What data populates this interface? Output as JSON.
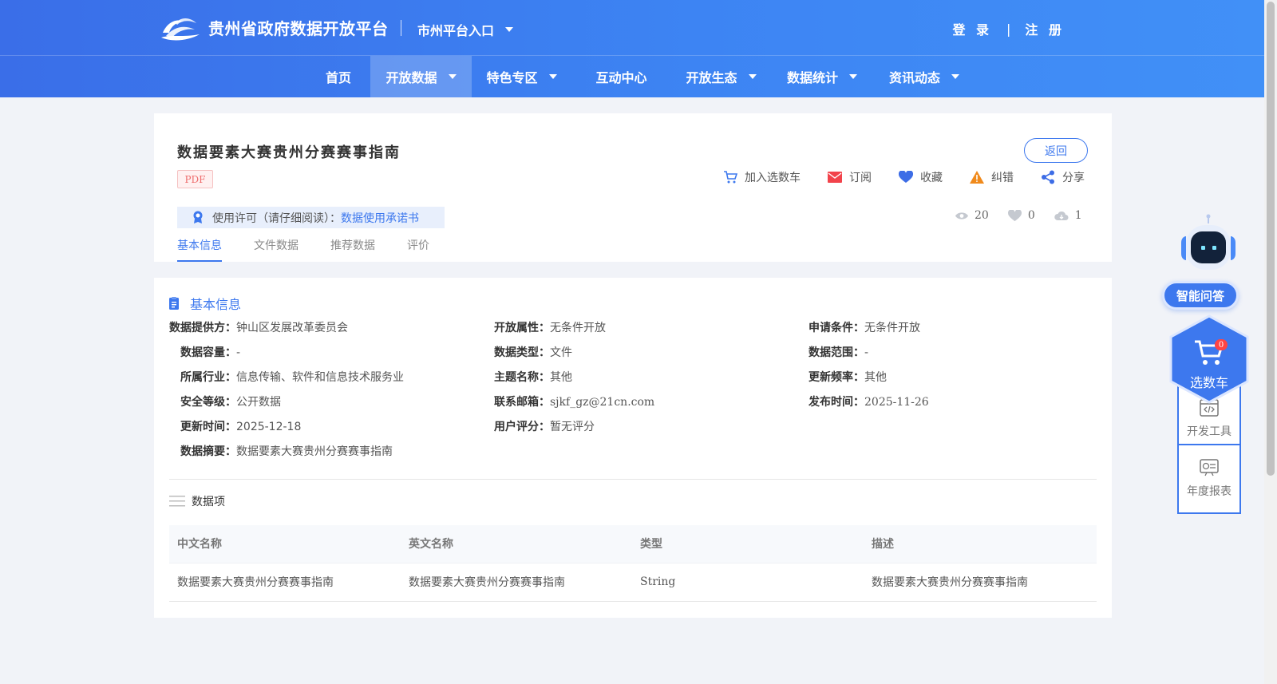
{
  "header": {
    "site_title": "贵州省政府数据开放平台",
    "city_entry": "市州平台入口",
    "login": "登 录",
    "separator": "|",
    "register": "注 册"
  },
  "nav": {
    "items": [
      {
        "label": "首页"
      },
      {
        "label": "开放数据"
      },
      {
        "label": "特色专区"
      },
      {
        "label": "互动中心"
      },
      {
        "label": "开放生态"
      },
      {
        "label": "数据统计"
      },
      {
        "label": "资讯动态"
      }
    ],
    "active": "开放数据"
  },
  "dataset": {
    "title": "数据要素大赛贵州分赛赛事指南",
    "format": "PDF",
    "back": "返回",
    "actions": [
      "加入选数车",
      "订阅",
      "收藏",
      "纠错",
      "分享"
    ],
    "license_label": "使用许可（请仔细阅读）：",
    "license_link": "数据使用承诺书",
    "views": "20",
    "likes": "0",
    "downloads": "1",
    "tabs": [
      "基本信息",
      "文件数据",
      "推荐数据",
      "评价"
    ]
  },
  "basic_info": {
    "heading": "基本信息",
    "fields": {
      "provider": {
        "k": "数据提供方：",
        "v": "钟山区发展改革委员会"
      },
      "capacity": {
        "k": "数据容量：",
        "v": "-"
      },
      "industry": {
        "k": "所属行业：",
        "v": "信息传输、软件和信息技术服务业"
      },
      "security": {
        "k": "安全等级：",
        "v": "公开数据"
      },
      "updated": {
        "k": "更新时间：",
        "v": "2025-12-18"
      },
      "summary": {
        "k": "数据摘要：",
        "v": "数据要素大赛贵州分赛赛事指南"
      },
      "open_attr": {
        "k": "开放属性：",
        "v": "无条件开放"
      },
      "data_type": {
        "k": "数据类型：",
        "v": "文件"
      },
      "topic": {
        "k": "主题名称：",
        "v": "其他"
      },
      "email": {
        "k": "联系邮箱：",
        "v": "sjkf_gz@21cn.com"
      },
      "rating": {
        "k": "用户评分：",
        "v": "暂无评分"
      },
      "apply": {
        "k": "申请条件：",
        "v": "无条件开放"
      },
      "scope": {
        "k": "数据范围：",
        "v": "-"
      },
      "frequency": {
        "k": "更新频率：",
        "v": "其他"
      },
      "published": {
        "k": "发布时间：",
        "v": "2025-11-26"
      }
    }
  },
  "data_items": {
    "heading": "数据项",
    "columns": [
      "中文名称",
      "英文名称",
      "类型",
      "描述"
    ],
    "rows": [
      [
        "数据要素大赛贵州分赛赛事指南",
        "数据要素大赛贵州分赛赛事指南",
        "String",
        "数据要素大赛贵州分赛赛事指南"
      ]
    ]
  },
  "sidebar": {
    "qa": "智能问答",
    "cart": "选数车",
    "cart_count": "0",
    "tools": [
      "开发工具",
      "年度报表"
    ]
  },
  "colors": {
    "primary": "#3d78ee",
    "header_start": "#3a6ee8",
    "header_end": "#4190f7",
    "alert": "#f44336"
  }
}
